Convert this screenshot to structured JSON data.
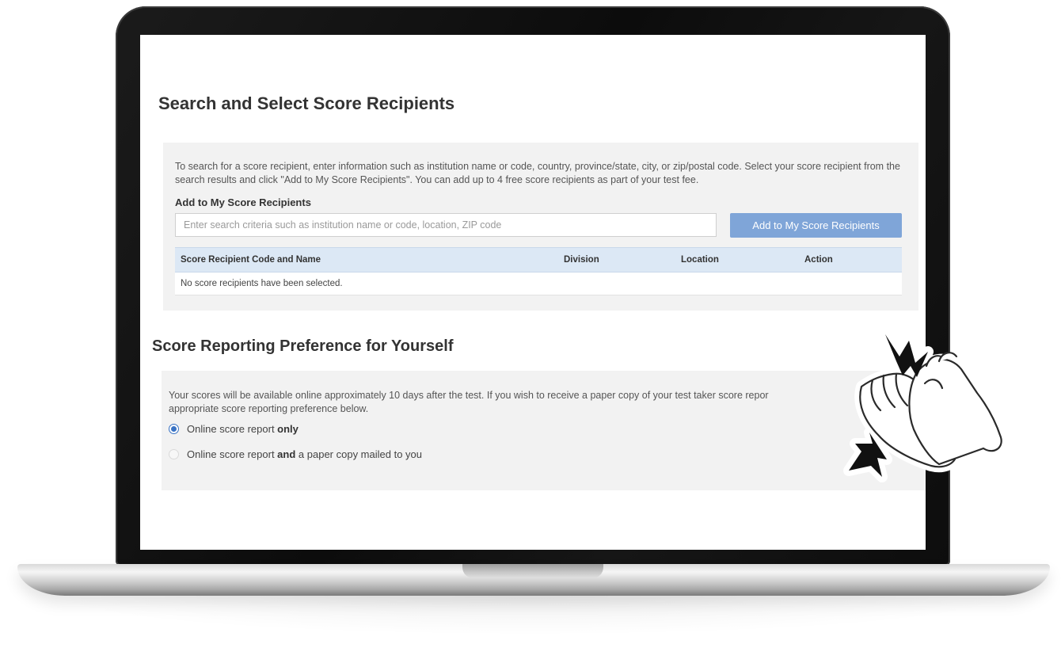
{
  "search_section": {
    "title": "Search and Select Score Recipients",
    "instructions": "To search for a score recipient, enter information such as institution name or code, country, province/state, city, or zip/postal code. Select your score recipient from the search results and click \"Add to My Score Recipients\". You can add up to 4 free score recipients as part of your test fee.",
    "add_heading": "Add to My Score Recipients",
    "search_placeholder": "Enter search criteria such as institution name or code, location, ZIP code",
    "search_value": "",
    "add_button_label": "Add to My Score Recipients",
    "table": {
      "columns": [
        "Score Recipient Code and Name",
        "Division",
        "Location",
        "Action"
      ],
      "empty_message": "No score recipients have been selected."
    }
  },
  "preference_section": {
    "title": "Score Reporting Preference for Yourself",
    "instructions": "Your scores will be available online approximately 10 days after the test. If you wish to receive a paper copy of your test taker score repor",
    "instructions_line2": "appropriate score reporting preference below.",
    "options": [
      {
        "label_pre": "Online score report ",
        "label_bold": "only",
        "label_post": "",
        "selected": true
      },
      {
        "label_pre": "Online score report ",
        "label_bold": "and",
        "label_post": " a paper copy mailed to you",
        "selected": false
      }
    ]
  },
  "colors": {
    "primary_button": "#7fa5d8",
    "table_header": "#dce8f5",
    "panel_background": "#f2f2f2",
    "radio_accent": "#3a73c4"
  },
  "sticker": {
    "icon": "clapping-hands-icon"
  }
}
